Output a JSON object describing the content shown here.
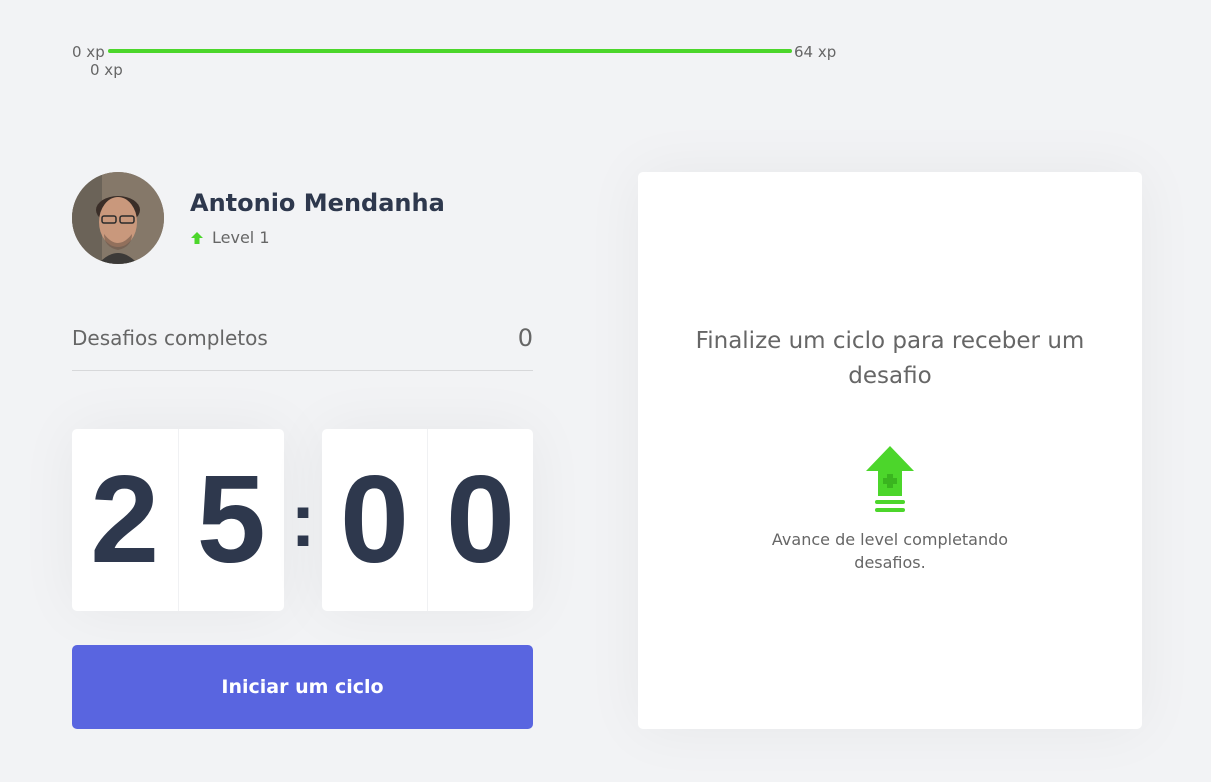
{
  "xp_bar": {
    "min_label": "0 xp",
    "max_label": "64 xp",
    "current_label": "0 xp",
    "progress_percent": 100,
    "fill_color": "#4cd62b"
  },
  "profile": {
    "name": "Antonio Mendanha",
    "level": "Level 1",
    "level_icon": "level-up-arrow-icon"
  },
  "challenges": {
    "label": "Desafios completos",
    "count": "0"
  },
  "countdown": {
    "minute_left": "2",
    "minute_right": "5",
    "separator": ":",
    "second_left": "0",
    "second_right": "0"
  },
  "start_button": {
    "label": "Iniciar um ciclo",
    "color": "#5965e0"
  },
  "challenge_box": {
    "title": "Finalize um ciclo para receber um desafio",
    "icon": "level-up-icon",
    "hint": "Avance de level completando desafios."
  }
}
